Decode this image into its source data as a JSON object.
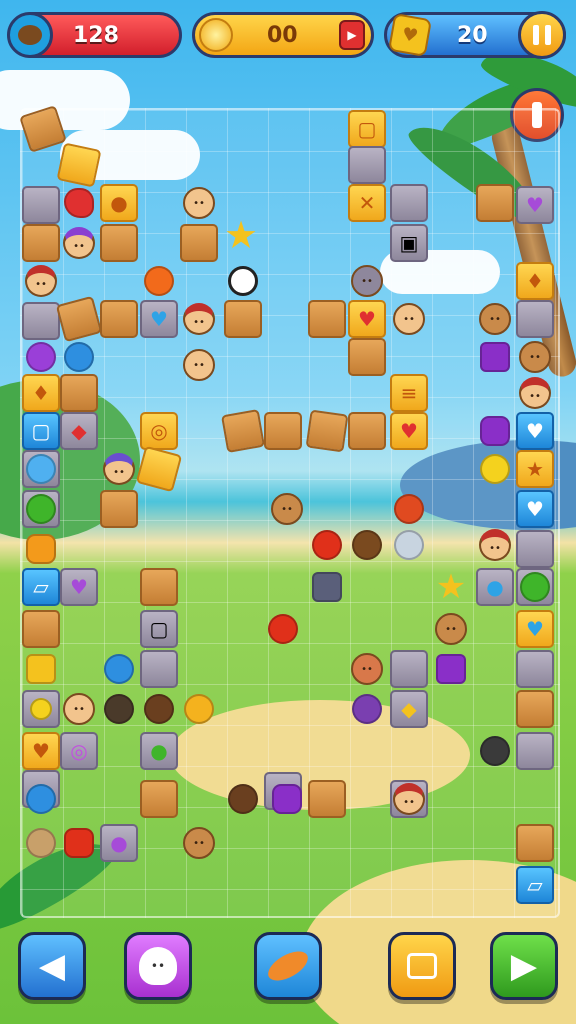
{
  "hud": {
    "score": "128",
    "coins": "00",
    "gems": "20"
  },
  "icons": {
    "avatar": "coconut-icon",
    "coin": "coin-icon",
    "gem": "gold-heart-gem-icon",
    "pause": "pause-icon",
    "menu_bubble": "orange-menu-icon"
  },
  "bottom_bar": {
    "buttons": [
      {
        "name": "back-button",
        "icon": "triangle-left-icon",
        "color": "#2f8be8"
      },
      {
        "name": "character-button",
        "icon": "ghost-character-icon",
        "color": "#c24ee0"
      },
      {
        "name": "fish-booster-button",
        "icon": "fish-icon",
        "color": "#2ea3e6"
      },
      {
        "name": "calendar-button",
        "icon": "calendar-icon",
        "color": "#f3a21b"
      },
      {
        "name": "play-button",
        "icon": "triangle-right-icon",
        "color": "#3fb52a"
      }
    ]
  },
  "colors": {
    "score_bar": "#e0303a",
    "coin_bar": "#f5b21c",
    "gem_bar": "#2f8be8",
    "board_border": "#ffffff"
  }
}
